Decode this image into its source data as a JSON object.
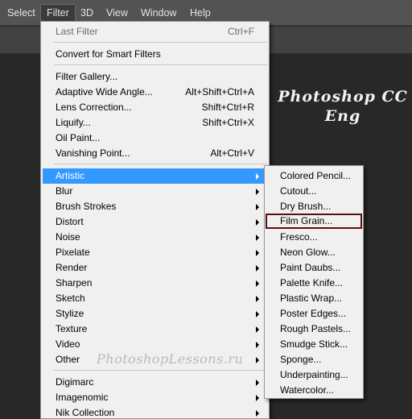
{
  "menubar": {
    "items": [
      "Select",
      "Filter",
      "3D",
      "View",
      "Window",
      "Help"
    ]
  },
  "brand": {
    "line1": "Photoshop CC",
    "line2": "Eng"
  },
  "watermark": "PhotoshopLessons.ru",
  "filter_menu": {
    "last_filter": {
      "label": "Last Filter",
      "shortcut": "Ctrl+F"
    },
    "convert": "Convert for Smart Filters",
    "group1": [
      {
        "label": "Filter Gallery...",
        "shortcut": ""
      },
      {
        "label": "Adaptive Wide Angle...",
        "shortcut": "Alt+Shift+Ctrl+A"
      },
      {
        "label": "Lens Correction...",
        "shortcut": "Shift+Ctrl+R"
      },
      {
        "label": "Liquify...",
        "shortcut": "Shift+Ctrl+X"
      },
      {
        "label": "Oil Paint...",
        "shortcut": ""
      },
      {
        "label": "Vanishing Point...",
        "shortcut": "Alt+Ctrl+V"
      }
    ],
    "submenus": [
      "Artistic",
      "Blur",
      "Brush Strokes",
      "Distort",
      "Noise",
      "Pixelate",
      "Render",
      "Sharpen",
      "Sketch",
      "Stylize",
      "Texture",
      "Video",
      "Other"
    ],
    "plugins": [
      "Digimarc",
      "Imagenomic",
      "Nik Collection"
    ]
  },
  "artistic_menu": {
    "items": [
      "Colored Pencil...",
      "Cutout...",
      "Dry Brush...",
      "Film Grain...",
      "Fresco...",
      "Neon Glow...",
      "Paint Daubs...",
      "Palette Knife...",
      "Plastic Wrap...",
      "Poster Edges...",
      "Rough Pastels...",
      "Smudge Stick...",
      "Sponge...",
      "Underpainting...",
      "Watercolor..."
    ]
  },
  "colors": {
    "highlight": "#3399ff",
    "menu_bg": "#f0f0f0",
    "app_bg": "#282828",
    "selection_box": "#5a0f0f"
  }
}
